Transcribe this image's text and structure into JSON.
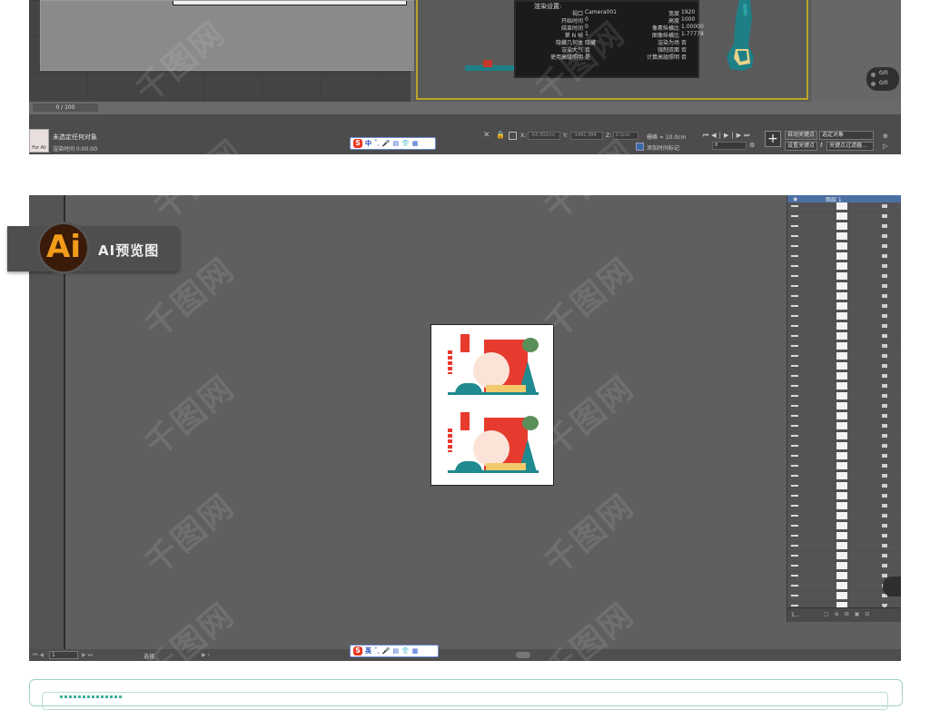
{
  "max": {
    "frame_counter": "0 / 100",
    "status_no_selection": "未选定任何对象",
    "status_render_time": "渲染时间  0:00:00",
    "swatch_text": "For All",
    "render_settings": {
      "title": "渲染设置:",
      "rows_left": [
        {
          "label": "视口",
          "value": "Camera001"
        },
        {
          "label": "开始时间",
          "value": "0"
        },
        {
          "label": "结束时间",
          "value": "0"
        },
        {
          "label": "第 N 帧",
          "value": "1"
        },
        {
          "label": "隐藏几何体",
          "value": "隐藏"
        },
        {
          "label": "渲染大气",
          "value": "否"
        },
        {
          "label": "使用高级照明",
          "value": "是"
        }
      ],
      "rows_right": [
        {
          "label": "宽度",
          "value": "1920"
        },
        {
          "label": "高度",
          "value": "1000"
        },
        {
          "label": "像素纵横比",
          "value": "1.00000"
        },
        {
          "label": "图像纵横比",
          "value": "1.77778"
        },
        {
          "label": "渲染为场",
          "value": "否"
        },
        {
          "label": "强制双面",
          "value": "否"
        },
        {
          "label": "计算高级照明",
          "value": "否"
        }
      ]
    },
    "coords": {
      "x_label": "X:",
      "x_value": "-54.302cm",
      "y_label": "Y:",
      "y_value": "-1491.384",
      "z_label": "Z:",
      "z_value": "0.0cm"
    },
    "grid_label": "栅格 = 10.0cm",
    "add_time_tag": "添加时间标记",
    "auto_key": "自动关键点",
    "set_key": "设置关键点",
    "selected_object": "选定对象",
    "key_filter": "关键点过滤器...",
    "frame_value": "0",
    "pills": [
      "0/0",
      "0/0"
    ]
  },
  "ime_top": {
    "logo": "S",
    "mode": "中",
    "icons": [
      "punct-icon",
      "mic-icon",
      "keyboard-icon",
      "shirt-icon",
      "grid-icon"
    ]
  },
  "ime_bottom": {
    "logo": "S",
    "mode": "英",
    "icons": [
      "punct-icon",
      "mic-icon",
      "keyboard-icon",
      "shirt-icon",
      "grid-icon"
    ]
  },
  "ai": {
    "badge_logo": "Ai",
    "badge_label": "AI预览图",
    "layer_name": "图层 1",
    "status_zoom": "1",
    "status_tool": "选择",
    "layers_footer": "1..."
  },
  "watermark": "千图网",
  "colors": {
    "max_bg": "#5f5f5f",
    "ai_bg": "#5f5f5f",
    "card_red": "#e63b2e",
    "card_teal": "#1f8a8f",
    "ai_logo": "#f39c1a",
    "frame_yellow": "#b8a429"
  }
}
